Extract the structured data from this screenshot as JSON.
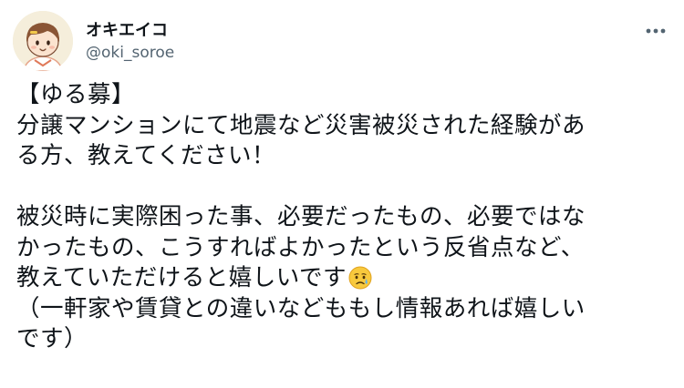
{
  "author": {
    "display_name": "オキエイコ",
    "handle": "@oki_soroe",
    "avatar_icon": "cartoon-face-avatar"
  },
  "menu": {
    "more_icon": "more-options-icon"
  },
  "tweet": {
    "lines": [
      "【ゆる募】",
      "分譲マンションにて地震など災害被災された経験があ",
      "る方、教えてください！",
      "",
      "被災時に実際困った事、必要だったもの、必要ではな",
      "かったもの、こうすればよかったという反省点など、",
      "教えていただけると嬉しいです",
      "（一軒家や賃貸との違いなどももし情報あれば嬉しい",
      "です）"
    ],
    "emoji": "crying-face-emoji"
  },
  "colors": {
    "text": "#0f1419",
    "secondary": "#536471"
  }
}
